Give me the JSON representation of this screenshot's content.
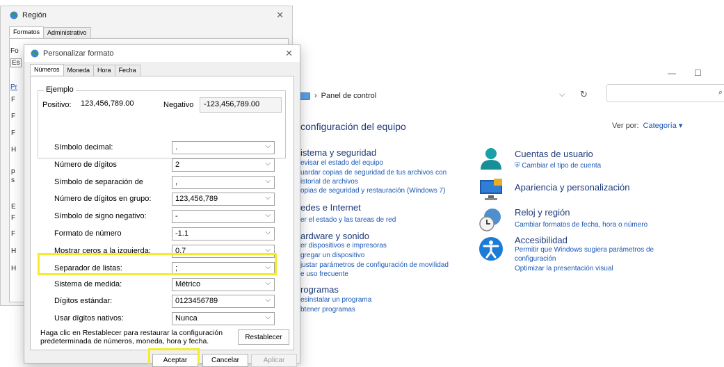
{
  "control_panel": {
    "address_label": "Panel de control",
    "page_title": "configuración del equipo",
    "view_by_label": "Ver por:",
    "view_by_value": "Categoría",
    "categories_left": [
      {
        "title": "istema y seguridad",
        "links": [
          "evisar el estado del equipo",
          "uardar copias de seguridad de tus archivos con",
          "istorial de archivos",
          "opias de seguridad y restauración (Windows 7)"
        ]
      },
      {
        "title": "edes e Internet",
        "links": [
          "er el estado y las tareas de red"
        ]
      },
      {
        "title": "ardware y sonido",
        "links": [
          "er dispositivos e impresoras",
          "gregar un dispositivo",
          "justar parámetros de configuración de movilidad",
          "e uso frecuente"
        ]
      },
      {
        "title": "rogramas",
        "links": [
          "esinstalar un programa",
          "btener programas"
        ]
      }
    ],
    "categories_right": [
      {
        "title": "Cuentas de usuario",
        "links": [
          "Cambiar el tipo de cuenta"
        ]
      },
      {
        "title": "Apariencia y personalización",
        "links": []
      },
      {
        "title": "Reloj y región",
        "links": [
          "Cambiar formatos de fecha, hora o número"
        ]
      },
      {
        "title": "Accesibilidad",
        "links": [
          "Permitir que Windows sugiera parámetros de",
          "configuración",
          "Optimizar la presentación visual"
        ]
      }
    ],
    "colors": {
      "heading": "#1e3a7a",
      "link": "#1a58b6"
    }
  },
  "region_dialog": {
    "title": "Región",
    "tabs": [
      "Formatos",
      "Administrativo"
    ],
    "fragments": {
      "fo": "Fo",
      "es": "Es",
      "pr": "Pr",
      "f": "F",
      "h": "H",
      "p": "p",
      "s": "s",
      "e": "E"
    }
  },
  "format_dialog": {
    "title": "Personalizar formato",
    "tabs": [
      "Números",
      "Moneda",
      "Hora",
      "Fecha"
    ],
    "example": {
      "legend": "Ejemplo",
      "positive_label": "Positivo:",
      "positive_value": "123,456,789.00",
      "negative_label": "Negativo",
      "negative_value": "-123,456,789.00"
    },
    "settings": [
      {
        "label": "Símbolo decimal:",
        "value": "."
      },
      {
        "label": "Número de dígitos",
        "value": "2"
      },
      {
        "label": "Símbolo de separación de",
        "value": ","
      },
      {
        "label": "Número de dígitos en grupo:",
        "value": "123,456,789"
      },
      {
        "label": "Símbolo de signo negativo:",
        "value": "-"
      },
      {
        "label": "Formato de número",
        "value": "-1.1"
      },
      {
        "label": "Mostrar ceros a la izquierda:",
        "value": "0.7"
      },
      {
        "label": "Separador de listas:",
        "value": ";"
      },
      {
        "label": "Sistema de medida:",
        "value": "Métrico"
      },
      {
        "label": "Dígitos estándar:",
        "value": "0123456789"
      },
      {
        "label": "Usar dígitos nativos:",
        "value": "Nunca"
      }
    ],
    "note": "Haga clic en Restablecer para restaurar la configuración predeterminada de números, moneda, hora y fecha.",
    "buttons": {
      "reset": "Restablecer",
      "accept": "Aceptar",
      "cancel": "Cancelar",
      "apply": "Aplicar"
    },
    "highlight_color": "#f4ec2c"
  }
}
